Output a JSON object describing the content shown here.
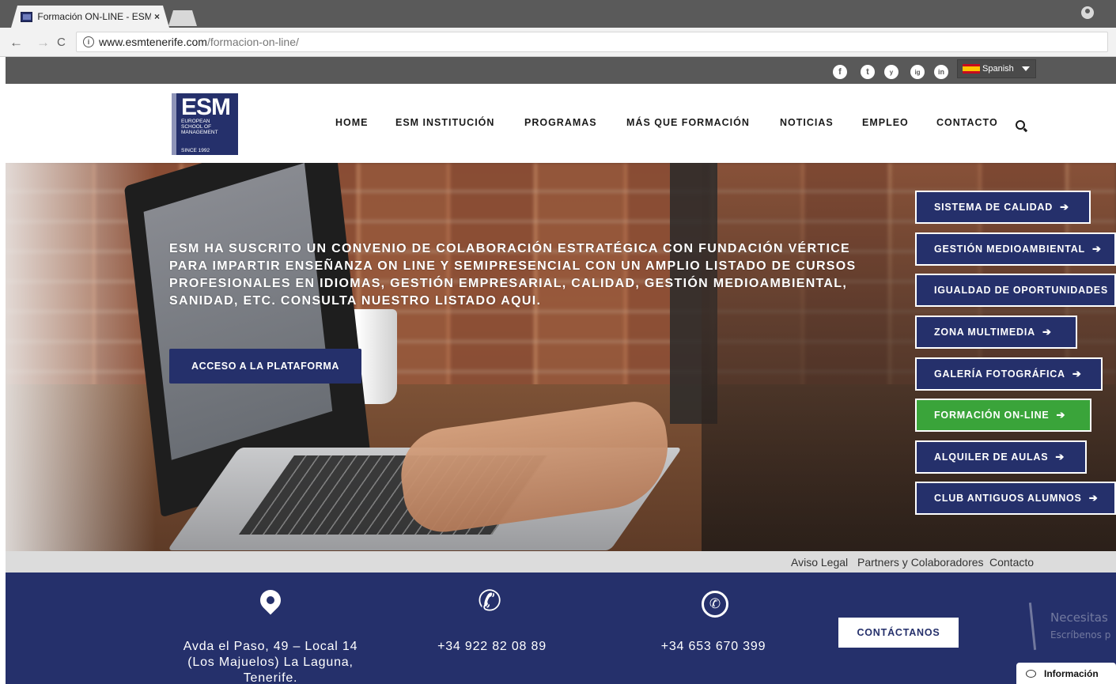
{
  "browser": {
    "tab_title": "Formación ON-LINE - ESM",
    "tab_close": "×",
    "url_domain": "www.esmtenerife.com",
    "url_path": "/formacion-on-line/",
    "back": "←",
    "forward": "→",
    "reload": "C",
    "info": "i"
  },
  "topbar": {
    "social": [
      "f",
      "t",
      "y",
      "ig",
      "in"
    ],
    "language": "Spanish"
  },
  "logo": {
    "big": "ESM",
    "line1": "EUROPEAN",
    "line2": "SCHOOL OF",
    "line3": "MANAGEMENT",
    "since": "SINCE 1992"
  },
  "menu": {
    "items": [
      "HOME",
      "ESM INSTITUCIÓN",
      "PROGRAMAS",
      "MÁS QUE FORMACIÓN",
      "NOTICIAS",
      "EMPLEO",
      "CONTACTO"
    ]
  },
  "hero": {
    "text": "ESM ha suscrito un convenio de colaboración estratégica con Fundación Vértice para impartir enseñanza on line y semipresencial con un amplio listado de cursos profesionales en idiomas, gestión empresarial, calidad, gestión medioambiental, sanidad, etc. Consulta nuestro listado aqui.",
    "cta": "ACCESO A LA PLATAFORMA"
  },
  "side_buttons": [
    {
      "label": "SISTEMA DE CALIDAD",
      "active": false
    },
    {
      "label": "GESTIÓN MEDIOAMBIENTAL",
      "active": false
    },
    {
      "label": "IGUALDAD DE OPORTUNIDADES",
      "active": false
    },
    {
      "label": "ZONA MULTIMEDIA",
      "active": false
    },
    {
      "label": "GALERÍA FOTOGRÁFICA",
      "active": false
    },
    {
      "label": "FORMACIÓN ON-LINE",
      "active": true
    },
    {
      "label": "ALQUILER DE AULAS",
      "active": false
    },
    {
      "label": "CLUB ANTIGUOS ALUMNOS",
      "active": false
    }
  ],
  "footer_links": [
    "Aviso Legal",
    "Partners y Colaboradores",
    "Contacto"
  ],
  "contact": {
    "address_1": "Avda el Paso, 49 – Local 14",
    "address_2": "(Los Majuelos) La Laguna,",
    "address_3": "Tenerife.",
    "phone": "+34 922 82 08 89",
    "whatsapp": "+34 653 670 399",
    "button": "CONTÁCTANOS",
    "chat_hint_1": "Necesitas",
    "chat_hint_2": "Escríbenos p",
    "chat_label": "Información"
  },
  "colors": {
    "brand_navy": "#25306b",
    "active_green": "#3aa43a",
    "topbar_gray": "#595959"
  }
}
